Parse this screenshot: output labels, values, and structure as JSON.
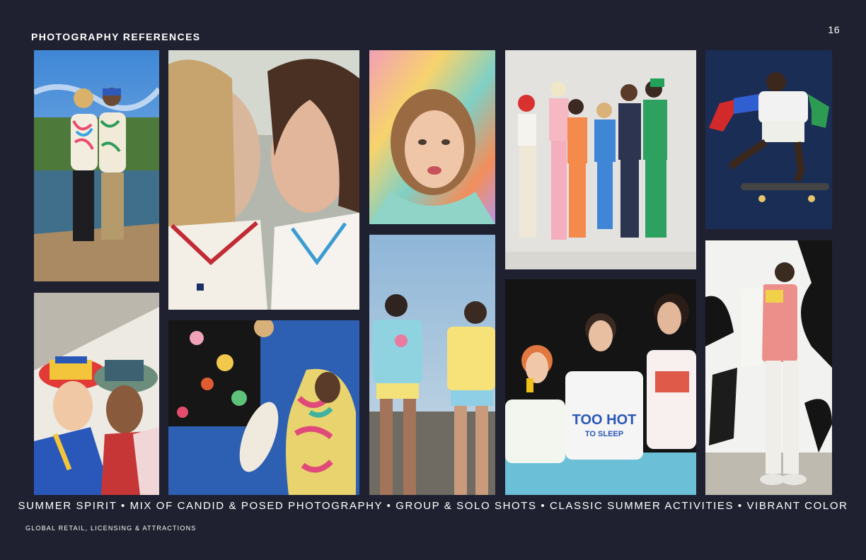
{
  "page": {
    "title": "PHOTOGRAPHY REFERENCES",
    "page_number": "16",
    "caption": "SUMMER SPIRIT • MIX OF CANDID & POSED PHOTOGRAPHY • GROUP & SOLO SHOTS • CLASSIC SUMMER ACTIVITIES • VIBRANT COLOR",
    "footer": "GLOBAL RETAIL, LICENSING & ATTRACTIONS"
  },
  "photos": {
    "p9_tee": {
      "text": "TOO HOT",
      "sub": "TO SLEEP"
    }
  },
  "colors": {
    "background": "#1f2130",
    "text": "#ffffff"
  }
}
